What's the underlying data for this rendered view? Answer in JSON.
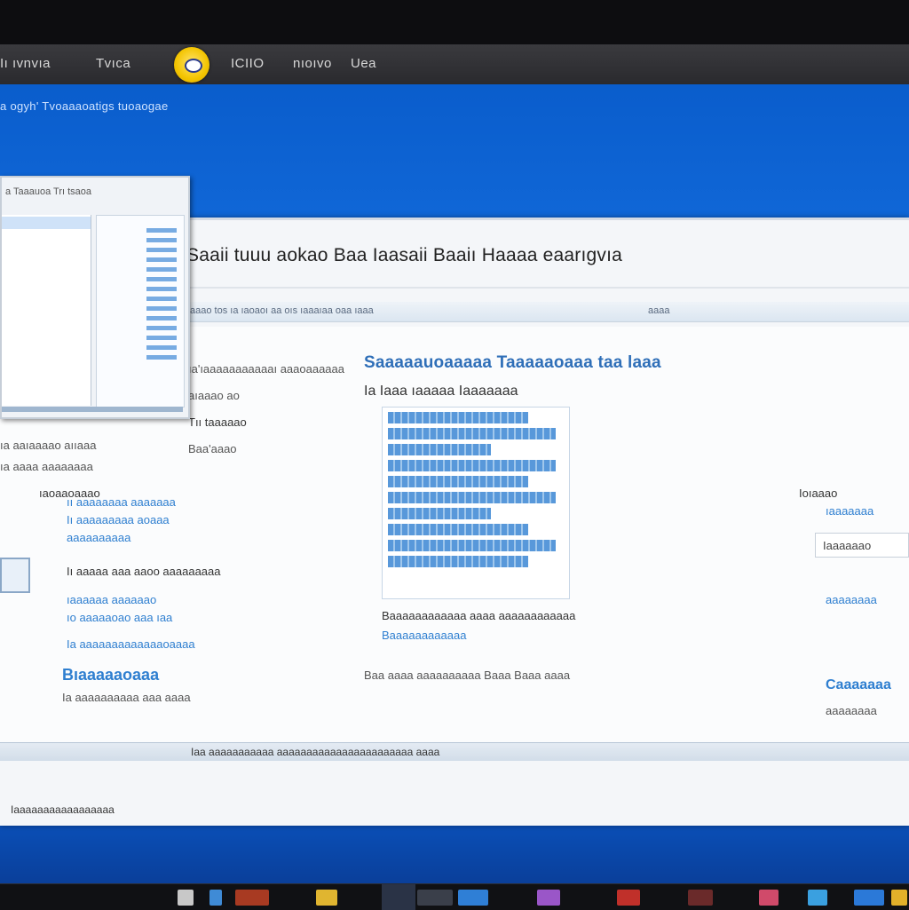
{
  "topbar": {
    "left_text_1": "Iı ıvnvıa",
    "left_text_2": "Tvıca",
    "right_text_1": "ICIIO",
    "right_text_2": "nıoıvo",
    "right_text_3": "Uea"
  },
  "desktop": {
    "header_text": "a ogyh' Tvoaaaoatigs tuoaogae"
  },
  "dialog": {
    "title": "a Taaauoa Trı tsaoa"
  },
  "window": {
    "title": "Saaii tuuu aokao Baa Iaasaii Baaiı Haaaa eaarıgvıa",
    "address_segments": [
      "aaao tos ıa  ıaoaoı aa oıs ıaaaıaa oaa ıaaa",
      "aaaa"
    ],
    "left_lines": [
      "Tıı taaaaao",
      "ıa'ıaaaaaaaaaaaı aaaoaaaaaa",
      "aıaaao ao",
      "Baa'aaao",
      "ıa aaıaaaao aııaaa",
      "ıa aaaa aaaaaaaa",
      "ıı aaaaaaaa aaaaaaa",
      "Iı aaaaaaaaa aoaaa",
      "ıaoaaoaaao",
      "aaaaaaaaaa",
      "Iı aaaaa aaa aaoo aaaaaaaaa",
      "ıaaaaaa aaaaaao",
      "ıo aaaaaoao aaa ıaa",
      "Ia aaaaaaaaaaaaaoaaaa",
      "Bıaaaaaoaaa",
      "Ia aaaaaaaaaa aaa aaaa"
    ],
    "center_heading": "Saaaaauoaaaaa Taaaaaoaaa taa laaa",
    "center_subheading": "Ia Iaaa ıaaaaa Iaaaaaaa",
    "center_lines": [
      "Baaaaaaaaaaaa aaaa aaaaaaaaaaaa",
      "Baaaaaaaaaaaa",
      "Baa  aaaa aaaaaaaaaa Baaa Baaa aaaa"
    ],
    "right_title": "Ioıaaao",
    "right_box": "Iaaaaaao",
    "right_lines": [
      "ıaaaaaaa",
      "aaaaaaaa",
      "Caaaaaaa",
      "aaaaaaaa"
    ],
    "status_text": "Iaa aaaaaaaaaaa aaaaaaaaaaaaaaaaaaaaaaa aaaa",
    "bottom_note": "Iaaaaaaaaaaaaaaaaa"
  },
  "colors": {
    "desktop_blue": "#1874e6",
    "link_blue": "#2f7fd0",
    "logo_yellow": "#f3c400"
  }
}
